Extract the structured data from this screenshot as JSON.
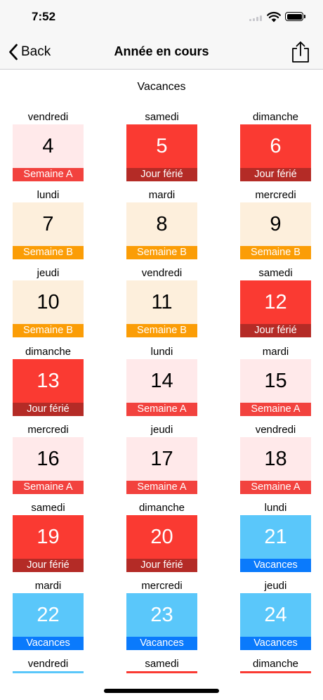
{
  "status_bar": {
    "time": "7:52"
  },
  "nav": {
    "back_label": "Back",
    "title": "Année en cours"
  },
  "section": {
    "title": "Vacances"
  },
  "legend_colors": {
    "Semaine A": {
      "bg": "#ffe9ea",
      "label": "#f2423e"
    },
    "Semaine B": {
      "bg": "#fdefdc",
      "label": "#fb9d06"
    },
    "Jour férié": {
      "bg": "#fa3a32",
      "label": "#b42b26"
    },
    "Vacances": {
      "bg": "#5ac7fa",
      "label": "#0a7afc"
    }
  },
  "days": [
    {
      "weekday": "vendredi",
      "number": "4",
      "label": "Semaine A",
      "type": "A"
    },
    {
      "weekday": "samedi",
      "number": "5",
      "label": "Jour férié",
      "type": "F"
    },
    {
      "weekday": "dimanche",
      "number": "6",
      "label": "Jour férié",
      "type": "F"
    },
    {
      "weekday": "lundi",
      "number": "7",
      "label": "Semaine B",
      "type": "B"
    },
    {
      "weekday": "mardi",
      "number": "8",
      "label": "Semaine B",
      "type": "B"
    },
    {
      "weekday": "mercredi",
      "number": "9",
      "label": "Semaine B",
      "type": "B"
    },
    {
      "weekday": "jeudi",
      "number": "10",
      "label": "Semaine B",
      "type": "B"
    },
    {
      "weekday": "vendredi",
      "number": "11",
      "label": "Semaine B",
      "type": "B"
    },
    {
      "weekday": "samedi",
      "number": "12",
      "label": "Jour férié",
      "type": "F"
    },
    {
      "weekday": "dimanche",
      "number": "13",
      "label": "Jour férié",
      "type": "F"
    },
    {
      "weekday": "lundi",
      "number": "14",
      "label": "Semaine A",
      "type": "A"
    },
    {
      "weekday": "mardi",
      "number": "15",
      "label": "Semaine A",
      "type": "A"
    },
    {
      "weekday": "mercredi",
      "number": "16",
      "label": "Semaine A",
      "type": "A"
    },
    {
      "weekday": "jeudi",
      "number": "17",
      "label": "Semaine A",
      "type": "A"
    },
    {
      "weekday": "vendredi",
      "number": "18",
      "label": "Semaine A",
      "type": "A"
    },
    {
      "weekday": "samedi",
      "number": "19",
      "label": "Jour férié",
      "type": "F"
    },
    {
      "weekday": "dimanche",
      "number": "20",
      "label": "Jour férié",
      "type": "F"
    },
    {
      "weekday": "lundi",
      "number": "21",
      "label": "Vacances",
      "type": "V"
    },
    {
      "weekday": "mardi",
      "number": "22",
      "label": "Vacances",
      "type": "V"
    },
    {
      "weekday": "mercredi",
      "number": "23",
      "label": "Vacances",
      "type": "V"
    },
    {
      "weekday": "jeudi",
      "number": "24",
      "label": "Vacances",
      "type": "V"
    }
  ],
  "partial_row": [
    {
      "weekday": "vendredi",
      "color": "#5ac7fa"
    },
    {
      "weekday": "samedi",
      "color": "#fa3a32"
    },
    {
      "weekday": "dimanche",
      "color": "#fa3a32"
    }
  ]
}
